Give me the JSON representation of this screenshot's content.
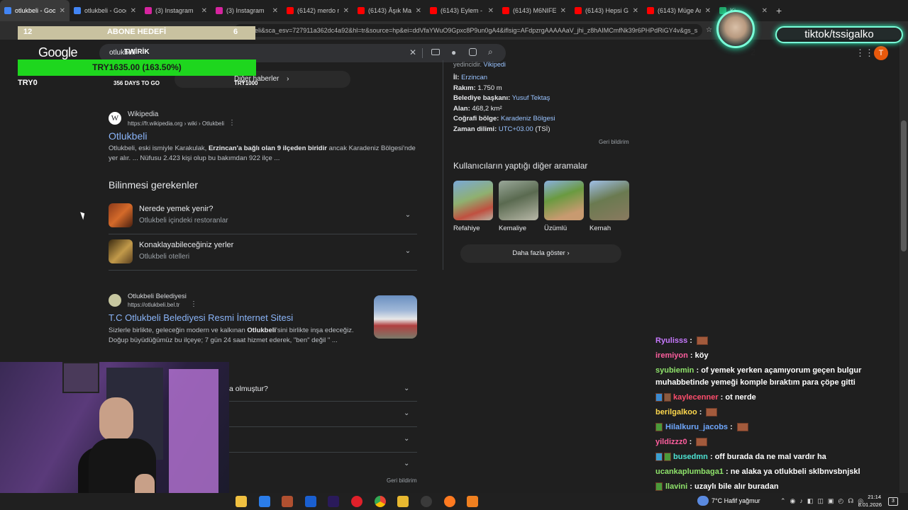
{
  "tabs": [
    {
      "label": "otlukbeli - Google",
      "color": "#4285f4"
    },
    {
      "label": "otlukbeli - Google",
      "color": "#4285f4"
    },
    {
      "label": "(3) Instagram",
      "color": "#d6249f"
    },
    {
      "label": "(3) Instagram",
      "color": "#d6249f"
    },
    {
      "label": "(6142) merdo me",
      "color": "#ff0000"
    },
    {
      "label": "(6143) Âşık Mahz",
      "color": "#ff0000"
    },
    {
      "label": "(6143) Eylem - Ar",
      "color": "#ff0000"
    },
    {
      "label": "(6143) M6NIFEST",
      "color": "#ff0000"
    },
    {
      "label": "(6143) Hepsi Gru",
      "color": "#ff0000"
    },
    {
      "label": "(6143) Müge Anl",
      "color": "#ff0000"
    },
    {
      "label": "Ki",
      "color": "#21a366"
    }
  ],
  "address_bar": {
    "url": "tlukbeli&sca_esv=727911a362dc4a92&hl=tr&source=hp&ei=ddVfaYWuO9Gpxc8P9un0gA4&iflsig=AFdpzrgAAAAAaV_jhi_z8hAIMCmfNk39r6PHPdRiGY4v&gs_s"
  },
  "google": {
    "logo": "Google",
    "search_value": "otlukbeli",
    "more_news_label": "Diğer haberler",
    "wiki_result": {
      "source": "Wikipedia",
      "url": "https://fr.wikipedia.org › wiki › Otlukbeli",
      "title": "Otlukbeli",
      "snippet_1": "Otlukbeli, eski ismiyle Karakulak,",
      "snippet_bold": "Erzincan'a bağlı olan 9 ilçeden biridir",
      "snippet_2": "ancak Karadeniz Bölgesi'nde",
      "snippet_line2": "yer alır. ... Nüfusu 2.423 kişi olup bu bakımdan 922 ilçe ..."
    },
    "section_title": "Bilinmesi gerekenler",
    "accordion": [
      {
        "title": "Nerede yemek yenir?",
        "subtitle": "Otlukbeli içindeki restoranlar"
      },
      {
        "title": "Konaklayabileceğiniz yerler",
        "subtitle": "Otlukbeli otelleri"
      }
    ],
    "bel_result": {
      "source": "Otlukbeli Belediyesi",
      "url": "https://otlukbeli.bel.tr",
      "title": "T.C Otlukbeli Belediyesi Resmi İnternet Sitesi",
      "snippet_1": "Sizlerle birlikte, geleceğin modern ve kalkınan",
      "snippet_bold": "Otlukbeli",
      "snippet_2": "'sini birlikte inşa edeceğiz.",
      "snippet_line2": "Doğup büyüdüğümüz bu ilçeye; 7 gün 24 saat hizmet ederek, \"ben\" değil \" ..."
    },
    "faq_partial": "a olmuştur?",
    "feedback_bottom": "Geri bildirim",
    "knowledge_panel": {
      "top_text": "yedincidir.",
      "top_link": "Vikipedi",
      "rows": [
        {
          "label": "İl:",
          "value": "Erzincan",
          "is_link": true
        },
        {
          "label": "Rakım:",
          "value": "1.750 m",
          "is_link": false
        },
        {
          "label": "Belediye başkanı:",
          "value": "Yusuf Tektaş",
          "is_link": true
        },
        {
          "label": "Alan:",
          "value": "468,2 km²",
          "is_link": false
        },
        {
          "label": "Coğrafi bölge:",
          "value": "Karadeniz Bölgesi",
          "is_link": true
        },
        {
          "label": "Zaman dilimi:",
          "value": "UTC+03.00",
          "suffix": "(TSİ)",
          "is_link": true
        }
      ],
      "feedback": "Geri bildirim",
      "related_title": "Kullanıcıların yaptığı diğer aramalar",
      "related": [
        "Refahiye",
        "Kemaliye",
        "Üzümlü",
        "Kemah"
      ],
      "more_label": "Daha fazla göster"
    },
    "profile_initial": "T"
  },
  "goal_widget": {
    "left_number": "12",
    "title": "ABONE HEDEFİ",
    "right_number": "6",
    "sponsor_text": "TWİRİK",
    "amount": "TRY1635.00 (163.50%)",
    "start_label": "TRY0",
    "days_label": "356 DAYS TO GO",
    "goal_label": "TRY1000"
  },
  "overlay": {
    "tiktok_handle": "tiktok/tssigalko",
    "badge_number": "2"
  },
  "chat": [
    {
      "user": "Ryulisss",
      "color": "#c879ff",
      "text": "",
      "emote": true,
      "badges": 0
    },
    {
      "user": "iremiyon",
      "color": "#ff5e9e",
      "text": "köy",
      "emote": false,
      "badges": 0
    },
    {
      "user": "syubiemin",
      "color": "#8fe36b",
      "text": "of yemek yerken açamıyorum geçen bulgur",
      "emote": false,
      "badges": 0
    },
    {
      "user": "",
      "color": "#ffffff",
      "text": "muhabbetinde yemeği komple bıraktım para çöpe gitti",
      "emote": false,
      "badges": 0
    },
    {
      "user": "kaylecenner",
      "color": "#ff4d6d",
      "text": "ot nerde",
      "emote": false,
      "badges": 2
    },
    {
      "user": "berilgalkoo",
      "color": "#ffd84d",
      "text": "",
      "emote": true,
      "badges": 0
    },
    {
      "user": "Hilalkuru_jacobs",
      "color": "#6fa8ff",
      "text": "",
      "emote": true,
      "badges": 1
    },
    {
      "user": "yildizzz0",
      "color": "#ff5e9e",
      "text": "",
      "emote": true,
      "badges": 0
    },
    {
      "user": "busedmn",
      "color": "#4de3d3",
      "text": "off burada da ne mal vardır ha",
      "emote": false,
      "badges": 2
    },
    {
      "user": "ucankaplumbaga1",
      "color": "#8fe36b",
      "text": "ne alaka ya otlukbeli sklbnvsbnjskl",
      "emote": false,
      "badges": 0
    },
    {
      "user": "llavini",
      "color": "#8fe36b",
      "text": "uzaylı bile alır buradan",
      "emote": false,
      "badges": 1
    }
  ],
  "taskbar": {
    "weather": "7°C  Hafif yağmur",
    "time": "21:14",
    "date": "8.01.2026",
    "notification_count": "3"
  }
}
